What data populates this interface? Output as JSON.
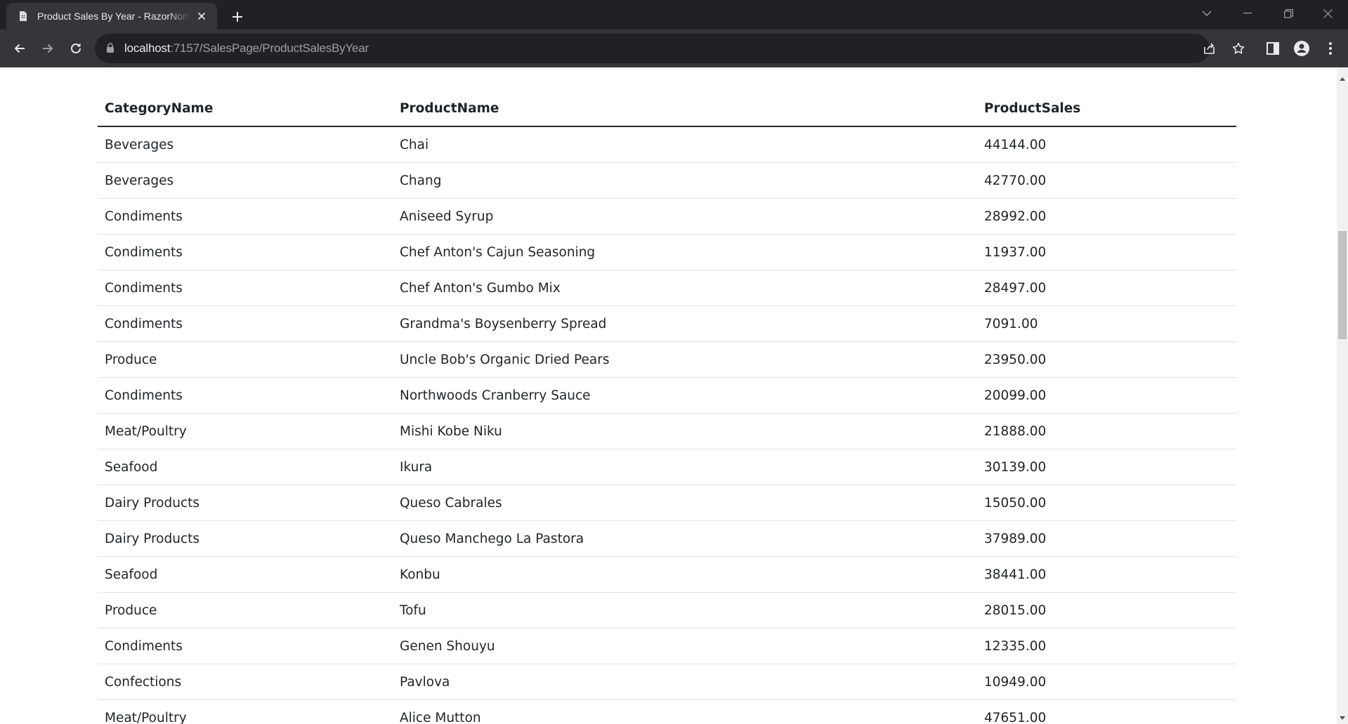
{
  "browser": {
    "tab_title": "Product Sales By Year - RazorNorthwind",
    "url_host": "localhost",
    "url_rest": ":7157/SalesPage/ProductSalesByYear",
    "icons": [
      "document-icon",
      "close-icon",
      "plus-icon",
      "chevron-down-icon",
      "minimize-icon",
      "restore-icon",
      "window-close-icon",
      "back-arrow-icon",
      "forward-arrow-icon",
      "reload-icon",
      "lock-icon",
      "share-icon",
      "star-icon",
      "sidebar-icon",
      "profile-icon",
      "more-vert-icon"
    ]
  },
  "table": {
    "headers": [
      "CategoryName",
      "ProductName",
      "ProductSales"
    ],
    "rows": [
      [
        "Beverages",
        "Chai",
        "44144.00"
      ],
      [
        "Beverages",
        "Chang",
        "42770.00"
      ],
      [
        "Condiments",
        "Aniseed Syrup",
        "28992.00"
      ],
      [
        "Condiments",
        "Chef Anton's Cajun Seasoning",
        "11937.00"
      ],
      [
        "Condiments",
        "Chef Anton's Gumbo Mix",
        "28497.00"
      ],
      [
        "Condiments",
        "Grandma's Boysenberry Spread",
        "7091.00"
      ],
      [
        "Produce",
        "Uncle Bob's Organic Dried Pears",
        "23950.00"
      ],
      [
        "Condiments",
        "Northwoods Cranberry Sauce",
        "20099.00"
      ],
      [
        "Meat/Poultry",
        "Mishi Kobe Niku",
        "21888.00"
      ],
      [
        "Seafood",
        "Ikura",
        "30139.00"
      ],
      [
        "Dairy Products",
        "Queso Cabrales",
        "15050.00"
      ],
      [
        "Dairy Products",
        "Queso Manchego La Pastora",
        "37989.00"
      ],
      [
        "Seafood",
        "Konbu",
        "38441.00"
      ],
      [
        "Produce",
        "Tofu",
        "28015.00"
      ],
      [
        "Condiments",
        "Genen Shouyu",
        "12335.00"
      ],
      [
        "Confections",
        "Pavlova",
        "10949.00"
      ],
      [
        "Meat/Poultry",
        "Alice Mutton",
        "47651.00"
      ]
    ]
  }
}
